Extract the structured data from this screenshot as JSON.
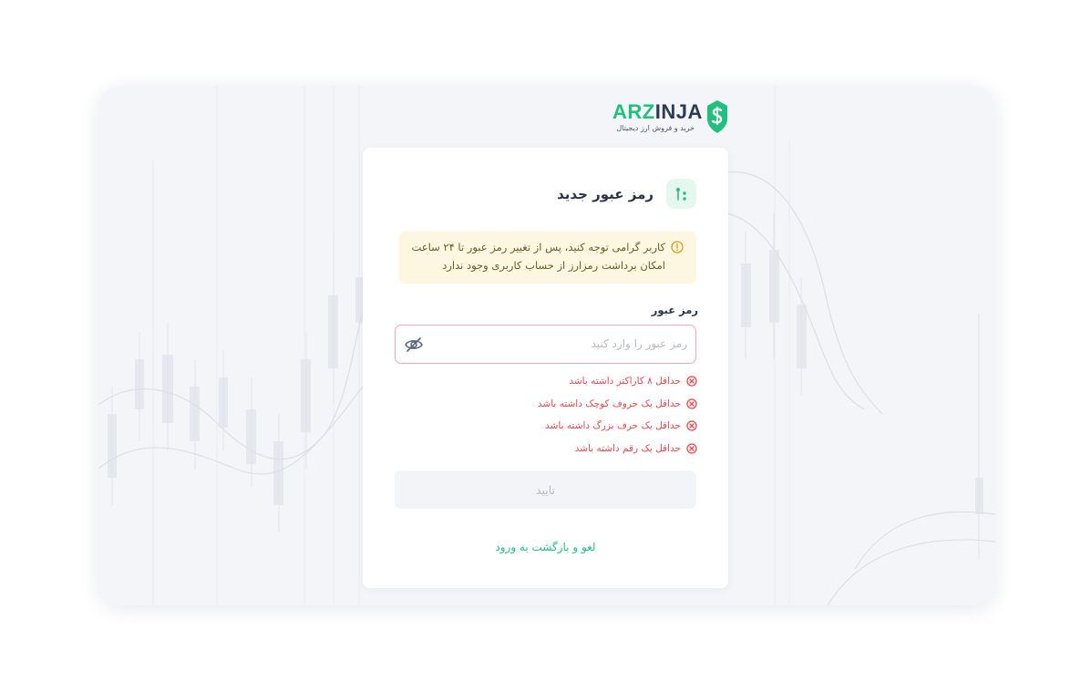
{
  "brand": {
    "name_accent": "ARZ",
    "name_rest": "INJA",
    "tagline": "خرید و فروش ارز دیجیتال",
    "accent_color": "#22c07e"
  },
  "form": {
    "title": "رمز عبور جدید",
    "header_icon": "key-dots-icon",
    "alert": {
      "icon": "warning-circle-icon",
      "text": "کاربر گرامی توجه کنید، پس از تغییر رمز عبور تا ۲۴ ساعت امکان برداشت رمزارز از حساب کاربری وجود ندارد"
    },
    "password_label": "رمز عبور",
    "password_placeholder": "رمز عبور را وارد کنید",
    "password_value": "",
    "visibility_icon": "eye-off-icon",
    "rules": [
      "حداقل ۸ کاراکتر داشته باشد",
      "حداقل یک حروف کوچک داشته باشد",
      "حداقل یک حرف بزرگ داشته باشد",
      "حداقل یک رقم داشته باشد"
    ],
    "rule_icon": "x-circle-icon",
    "error_color": "#e5484d",
    "submit_label": "تایید",
    "cancel_label": "لغو و بازگشت به ورود"
  }
}
